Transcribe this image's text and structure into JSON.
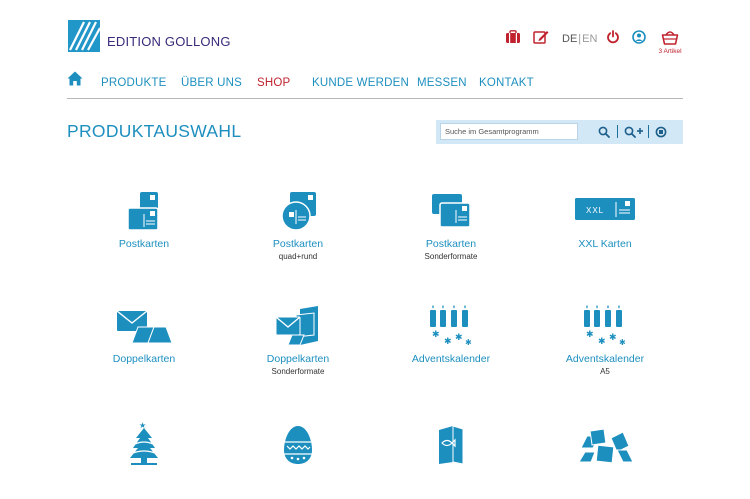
{
  "brand": {
    "name": "EDITION GOLLONG"
  },
  "header": {
    "lang_de": "DE",
    "lang_sep": "|",
    "lang_en": "EN",
    "cart_count": "3 Artikel"
  },
  "nav": {
    "items": [
      "PRODUKTE",
      "ÜBER UNS",
      "SHOP",
      "KUNDE WERDEN",
      "MESSEN",
      "KONTAKT"
    ],
    "active": "SHOP"
  },
  "page": {
    "title": "PRODUKTAUSWAHL"
  },
  "search": {
    "placeholder": "Suche im Gesamtprogramm"
  },
  "products": [
    {
      "label": "Postkarten",
      "sub": "",
      "icon": "postcards-icon"
    },
    {
      "label": "Postkarten",
      "sub": "quad+rund",
      "icon": "postcards-round-icon"
    },
    {
      "label": "Postkarten",
      "sub": "Sonderformate",
      "icon": "postcards-special-icon"
    },
    {
      "label": "XXL Karten",
      "sub": "",
      "icon": "xxl-card-icon"
    },
    {
      "label": "Doppelkarten",
      "sub": "",
      "icon": "double-card-icon"
    },
    {
      "label": "Doppelkarten",
      "sub": "Sonderformate",
      "icon": "double-card-special-icon"
    },
    {
      "label": "Adventskalender",
      "sub": "",
      "icon": "advent-calendar-icon"
    },
    {
      "label": "Adventskalender",
      "sub": "A5",
      "icon": "advent-calendar-a5-icon"
    },
    {
      "label": "",
      "sub": "",
      "icon": "christmas-tree-icon"
    },
    {
      "label": "",
      "sub": "",
      "icon": "easter-egg-icon"
    },
    {
      "label": "",
      "sub": "",
      "icon": "fish-card-icon"
    },
    {
      "label": "",
      "sub": "",
      "icon": "card-set-icon"
    }
  ],
  "colors": {
    "accent": "#1d8fbf",
    "active": "#c0232f",
    "brand_text": "#3a2a7a",
    "search_bg": "#d3e8f6"
  }
}
